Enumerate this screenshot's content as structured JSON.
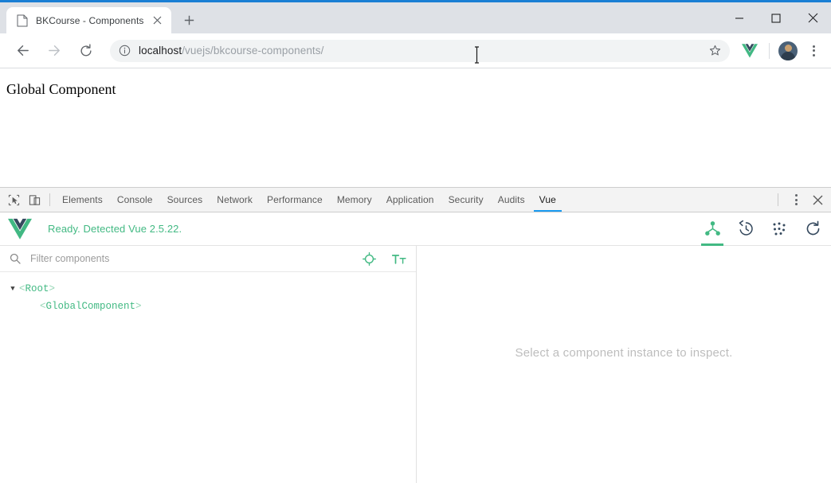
{
  "browser": {
    "tab": {
      "title": "BKCourse - Components",
      "favicon_icon": "page-icon",
      "close_icon": "close-icon"
    },
    "new_tab_icon": "plus-icon",
    "window_controls": {
      "minimize_icon": "minimize-icon",
      "maximize_icon": "maximize-icon",
      "close_icon": "close-icon"
    },
    "toolbar": {
      "back_icon": "arrow-left-icon",
      "forward_icon": "arrow-right-icon",
      "reload_icon": "reload-icon",
      "info_icon": "info-circle-icon",
      "url_host": "localhost",
      "url_path": "/vuejs/bkcourse-components/",
      "url_full": "localhost/vuejs/bkcourse-components/",
      "star_icon": "star-icon",
      "extension_icon": "vue-extension-icon",
      "avatar_icon": "profile-avatar",
      "menu_icon": "kebab-menu-icon"
    }
  },
  "page": {
    "heading": "Global Component"
  },
  "devtools": {
    "inspect_icon": "inspect-element-icon",
    "device_icon": "device-toolbar-icon",
    "tabs": [
      {
        "label": "Elements",
        "active": false
      },
      {
        "label": "Console",
        "active": false
      },
      {
        "label": "Sources",
        "active": false
      },
      {
        "label": "Network",
        "active": false
      },
      {
        "label": "Performance",
        "active": false
      },
      {
        "label": "Memory",
        "active": false
      },
      {
        "label": "Application",
        "active": false
      },
      {
        "label": "Security",
        "active": false
      },
      {
        "label": "Audits",
        "active": false
      },
      {
        "label": "Vue",
        "active": true
      }
    ],
    "more_icon": "kebab-menu-icon",
    "close_icon": "close-icon",
    "active_tab_underline_color": "#1a9bf0"
  },
  "vue_panel": {
    "logo_icon": "vue-logo-icon",
    "status": "Ready. Detected Vue 2.5.22.",
    "status_color": "#42b983",
    "actions": [
      {
        "name": "components-tab-icon",
        "active": true
      },
      {
        "name": "history-timetravel-icon",
        "active": false
      },
      {
        "name": "events-dots-icon",
        "active": false
      },
      {
        "name": "refresh-icon",
        "active": false
      }
    ],
    "filter": {
      "search_icon": "search-icon",
      "placeholder": "Filter components",
      "value": "",
      "target_icon": "select-target-icon",
      "text_size_icon": "text-size-icon"
    },
    "tree": [
      {
        "name": "Root",
        "depth": 0,
        "expanded": true,
        "open_bracket": "<",
        "close_bracket": ">"
      },
      {
        "name": "GlobalComponent",
        "depth": 1,
        "expanded": null,
        "open_bracket": "<",
        "close_bracket": ">"
      }
    ],
    "detail_empty_message": "Select a component instance to inspect."
  }
}
